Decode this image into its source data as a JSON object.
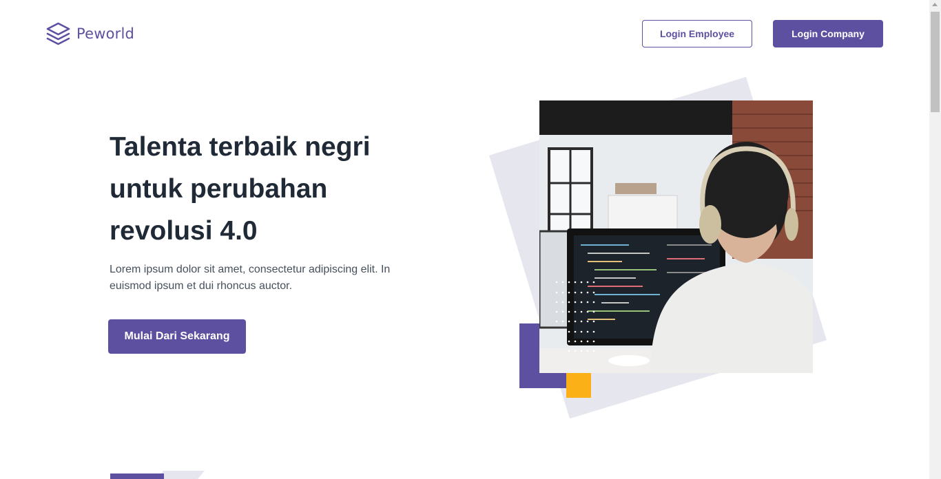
{
  "brand": {
    "name": "Peworld",
    "color": "#5E50A1"
  },
  "nav": {
    "login_employee": "Login Employee",
    "login_company": "Login Company"
  },
  "hero": {
    "title_line1": "Talenta terbaik negri",
    "title_line2": "untuk perubahan",
    "title_line3": "revolusi 4.0",
    "description": "Lorem ipsum dolor sit amet, consectetur adipiscing elit. In euismod ipsum et dui rhoncus auctor.",
    "cta": "Mulai Dari Sekarang"
  },
  "accent_colors": {
    "purple": "#5E50A1",
    "orange": "#FBB017",
    "gray": "#E6E6EF"
  },
  "icons": {
    "logo": "layers-icon"
  }
}
